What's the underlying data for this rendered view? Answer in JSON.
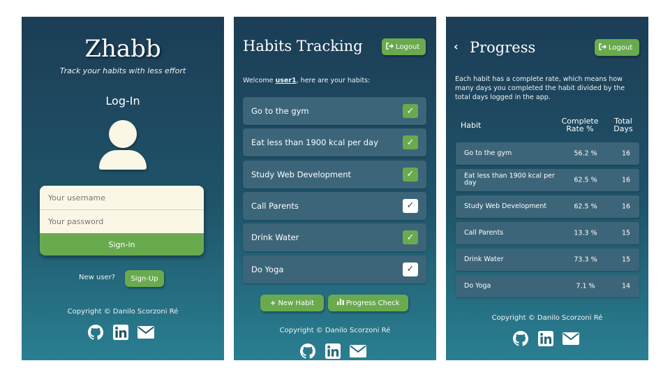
{
  "login": {
    "brand": "Zhabb",
    "tagline": "Track your habits with less effort",
    "heading": "Log-In",
    "username_placeholder": "Your username",
    "password_placeholder": "Your password",
    "signin_label": "Sign-in",
    "new_user_text": "New user?",
    "signup_label": "Sign-Up",
    "copyright": "Copyright © Danilo Scorzoni Ré"
  },
  "tracking": {
    "title": "Habits Tracking",
    "logout_label": "Logout",
    "welcome_prefix": "Welcome ",
    "username": "user1",
    "welcome_suffix": ", here are your habits:",
    "habits": [
      {
        "label": "Go to the gym",
        "checked": true
      },
      {
        "label": "Eat less than 1900 kcal per day",
        "checked": true
      },
      {
        "label": "Study Web Development",
        "checked": true
      },
      {
        "label": "Call Parents",
        "checked": false
      },
      {
        "label": "Drink Water",
        "checked": true
      },
      {
        "label": "Do Yoga",
        "checked": false
      }
    ],
    "new_habit_label": "New Habit",
    "progress_check_label": "Progress Check",
    "copyright": "Copyright © Danilo Scorzoni Ré"
  },
  "progress": {
    "back_glyph": "‹",
    "title": "Progress",
    "logout_label": "Logout",
    "intro": "Each habit has a complete rate, which means how many days you completed the habit divided by the total days logged in the app.",
    "headers": {
      "habit": "Habit",
      "rate_line1": "Complete",
      "rate_line2": "Rate %",
      "days_line1": "Total",
      "days_line2": "Days"
    },
    "rows": [
      {
        "habit": "Go to the gym",
        "rate": "56.2 %",
        "days": "16"
      },
      {
        "habit": "Eat less than 1900 kcal per day",
        "rate": "62.5 %",
        "days": "16"
      },
      {
        "habit": "Study Web Development",
        "rate": "62.5 %",
        "days": "16"
      },
      {
        "habit": "Call Parents",
        "rate": "13.3 %",
        "days": "15"
      },
      {
        "habit": "Drink Water",
        "rate": "73.3 %",
        "days": "15"
      },
      {
        "habit": "Do Yoga",
        "rate": "7.1 %",
        "days": "14"
      }
    ],
    "copyright": "Copyright © Danilo Scorzoni Ré"
  },
  "icons": [
    "github-icon",
    "linkedin-icon",
    "mail-icon",
    "logout-icon",
    "plus-icon",
    "bar-chart-icon",
    "user-avatar-icon",
    "check-icon"
  ],
  "colors": {
    "accent_green": "#6aaa4f",
    "panel_top": "#1c3d56",
    "panel_bottom": "#2a7f92",
    "cream": "#fbf7e6",
    "row_bg": "#3c6579"
  }
}
